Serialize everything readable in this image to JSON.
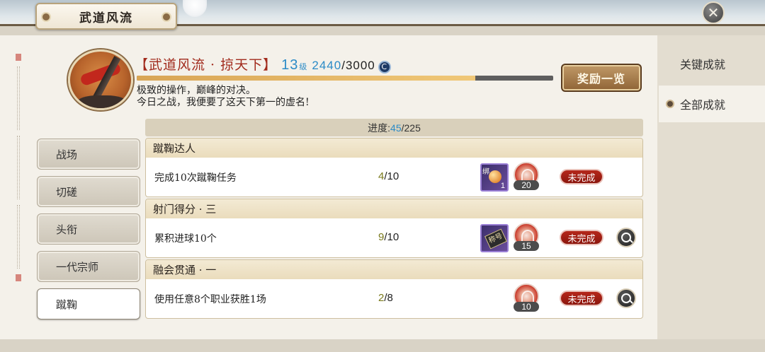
{
  "window": {
    "title": "武道风流",
    "close_icon": "close-icon"
  },
  "header": {
    "achievement_name": "【武道风流 · 掠天下】",
    "level": "13",
    "level_suffix": "级",
    "exp_current": "2440",
    "exp_separator": "/",
    "exp_max": "3000",
    "exp_fraction": 0.813,
    "currency_icon": "coin-icon",
    "description_line1": "极致的操作，巅峰的对决。",
    "description_line2": "今日之战，我便要了这天下第一的虚名!",
    "reward_button": "奖励一览"
  },
  "right_tabs": [
    {
      "label": "关键成就",
      "active": false
    },
    {
      "label": "全部成就",
      "active": true
    }
  ],
  "categories": [
    {
      "label": "战场",
      "active": false
    },
    {
      "label": "切磋",
      "active": false
    },
    {
      "label": "头衔",
      "active": false
    },
    {
      "label": "一代宗师",
      "active": false
    },
    {
      "label": "蹴鞠",
      "active": true
    }
  ],
  "progress": {
    "label": "进度:",
    "done": "45",
    "sep": "/",
    "total": "225"
  },
  "achievements": [
    {
      "title": "蹴鞠达人",
      "task": "完成10次蹴鞠任务",
      "prog_cur": "4",
      "prog_sep": "/",
      "prog_total": "10",
      "item_tag": "绑",
      "item_count": "1",
      "token_count": "20",
      "status": "未完成",
      "has_search": false
    },
    {
      "title": "射门得分 · 三",
      "task": "累积进球10个",
      "prog_cur": "9",
      "prog_sep": "/",
      "prog_total": "10",
      "item_tag": "称号",
      "token_count": "15",
      "status": "未完成",
      "has_search": true
    },
    {
      "title": "融会贯通 · 一",
      "task": "使用任意8个职业获胜1场",
      "prog_cur": "2",
      "prog_sep": "/",
      "prog_total": "8",
      "token_count": "10",
      "status": "未完成",
      "has_search": true
    }
  ],
  "colors": {
    "title_red": "#a12a1c",
    "level_blue": "#2b8bc7",
    "status_red": "#b5281b",
    "progress_gold": "#d8a555"
  }
}
